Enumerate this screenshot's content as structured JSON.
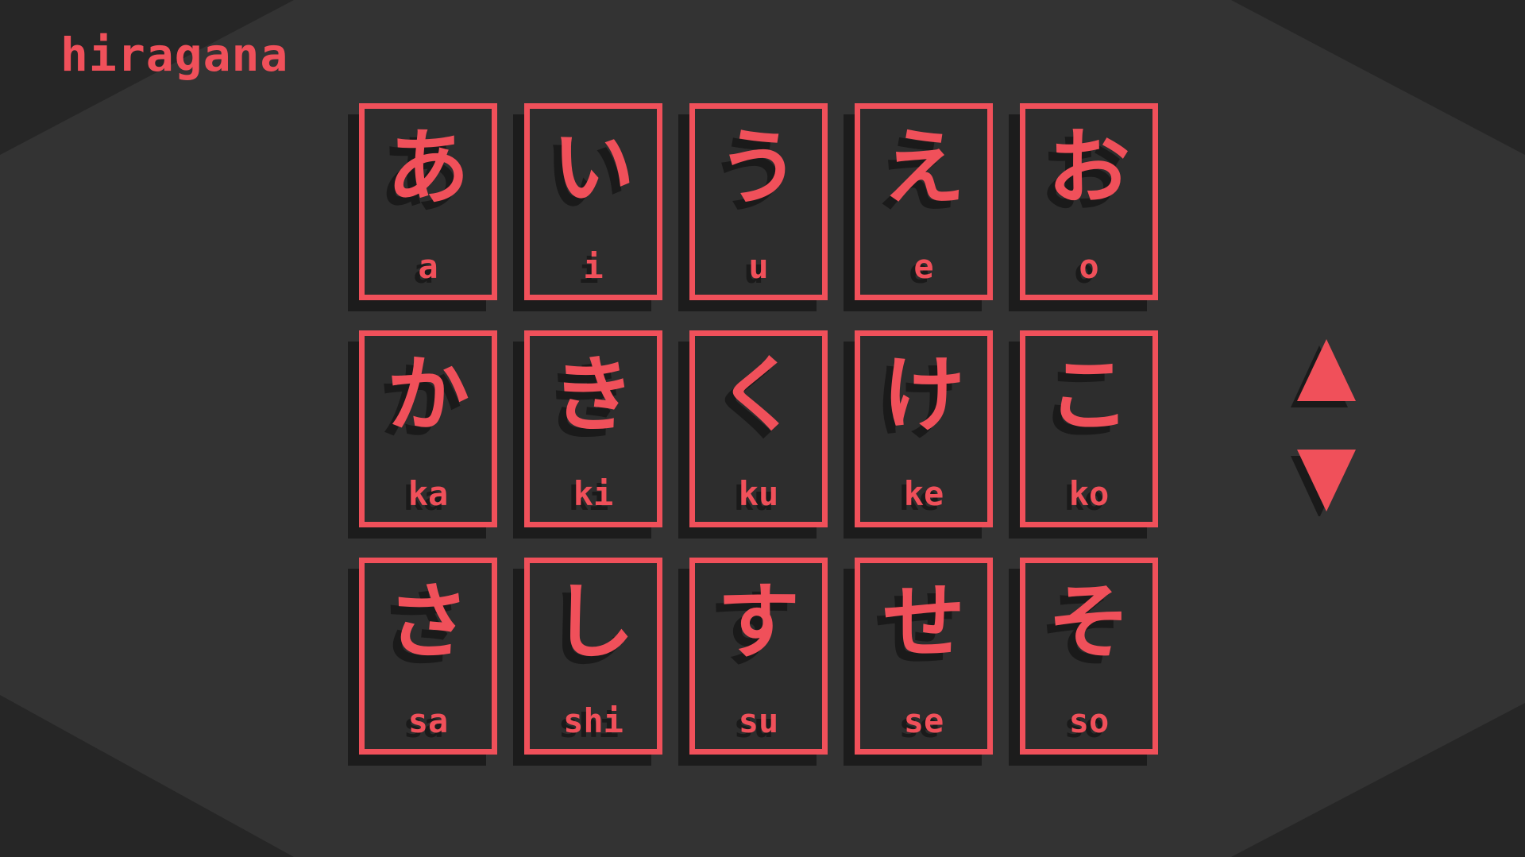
{
  "title": "hiragana",
  "colors": {
    "accent": "#f0505a",
    "background_outer": "#262626",
    "background_inner": "#333333",
    "shadow": "#1a1a1a"
  },
  "cards": [
    {
      "kana": "あ",
      "romaji": "a"
    },
    {
      "kana": "い",
      "romaji": "i"
    },
    {
      "kana": "う",
      "romaji": "u"
    },
    {
      "kana": "え",
      "romaji": "e"
    },
    {
      "kana": "お",
      "romaji": "o"
    },
    {
      "kana": "か",
      "romaji": "ka"
    },
    {
      "kana": "き",
      "romaji": "ki"
    },
    {
      "kana": "く",
      "romaji": "ku"
    },
    {
      "kana": "け",
      "romaji": "ke"
    },
    {
      "kana": "こ",
      "romaji": "ko"
    },
    {
      "kana": "さ",
      "romaji": "sa"
    },
    {
      "kana": "し",
      "romaji": "shi"
    },
    {
      "kana": "す",
      "romaji": "su"
    },
    {
      "kana": "せ",
      "romaji": "se"
    },
    {
      "kana": "そ",
      "romaji": "so"
    }
  ],
  "nav": {
    "up_icon": "triangle-up-icon",
    "down_icon": "triangle-down-icon"
  }
}
